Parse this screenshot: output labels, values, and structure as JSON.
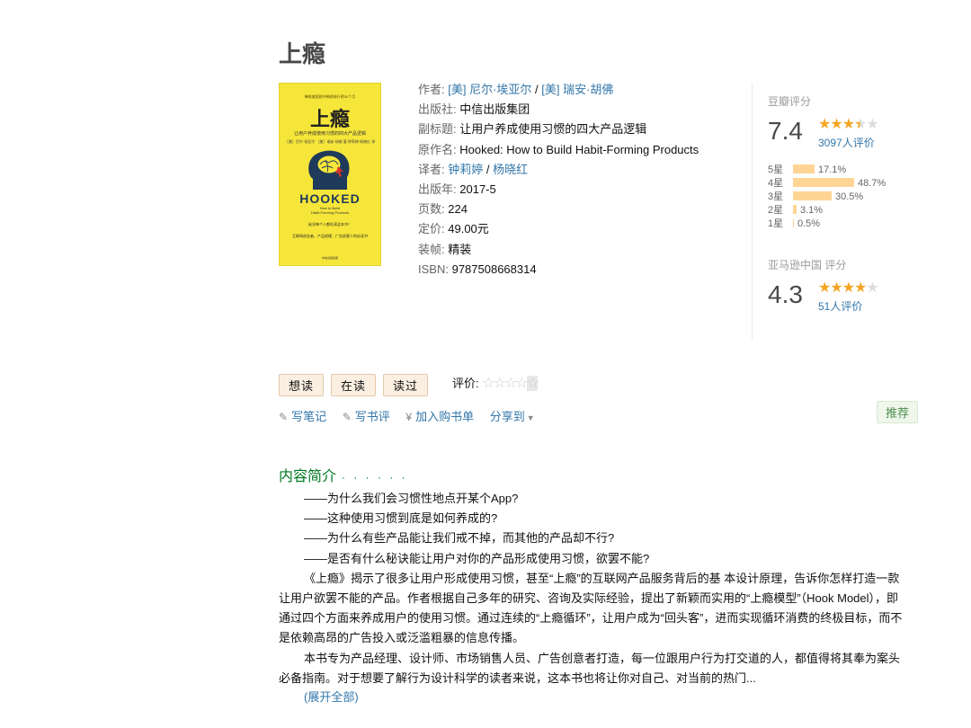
{
  "book": {
    "title": "上瘾",
    "cover": {
      "top_text": "蝉联美国图书畅销排行榜30个月",
      "title": "上瘾",
      "subtitle": "让用户养成使用习惯的四大产品逻辑",
      "authors": "［美］尼尔·埃亚尔  ［美］瑞安·胡佛 著  钟莉婷 杨晓红 译",
      "brand": "HOOKED",
      "en_line1": "How to Build",
      "en_line2": "Habit-Forming Products",
      "rec_line1": "硅谷每个人都在读这本书！",
      "rec_line2": "互联网创业者、产品经理、广告创意人的必读书",
      "publisher": "中信出版集团"
    },
    "info": {
      "author_label": "作者:",
      "author1": "[美] 尼尔·埃亚尔",
      "author_sep": " / ",
      "author2": "[美] 瑞安·胡佛",
      "publisher_label": "出版社:",
      "publisher": "中信出版集团",
      "subtitle_label": "副标题:",
      "subtitle": "让用户养成使用习惯的四大产品逻辑",
      "original_label": "原作名:",
      "original": "Hooked: How to Build Habit-Forming Products",
      "translator_label": "译者:",
      "translator1": "钟莉婷",
      "translator_sep": " / ",
      "translator2": "杨晓红",
      "year_label": "出版年:",
      "year": "2017-5",
      "pages_label": "页数:",
      "pages": "224",
      "price_label": "定价:",
      "price": "49.00元",
      "binding_label": "装帧:",
      "binding": "精装",
      "isbn_label": "ISBN:",
      "isbn": "9787508668314"
    }
  },
  "rating": {
    "douban_label": "豆瓣评分",
    "douban_score": "7.4",
    "douban_stars": 3.5,
    "douban_count": "3097人评价",
    "distribution": [
      {
        "star": "5星",
        "pct": "17.1%",
        "value": 17.1
      },
      {
        "star": "4星",
        "pct": "48.7%",
        "value": 48.7
      },
      {
        "star": "3星",
        "pct": "30.5%",
        "value": 30.5
      },
      {
        "star": "2星",
        "pct": "3.1%",
        "value": 3.1
      },
      {
        "star": "1星",
        "pct": "0.5%",
        "value": 0.5
      }
    ],
    "amazon_label": "亚马逊中国 评分",
    "amazon_score": "4.3",
    "amazon_stars": 4,
    "amazon_count": "51人评价"
  },
  "actions": {
    "want": "想读",
    "reading": "在读",
    "read": "读过",
    "my_rating_label": "评价:",
    "write_note": "写笔记",
    "write_review": "写书评",
    "add_cart": "加入购书单",
    "share": "分享到",
    "recommend": "推荐"
  },
  "intro": {
    "heading": "内容简介",
    "dots": "· · · · · ·",
    "q1": "——为什么我们会习惯性地点开某个App?",
    "q2": "——这种使用习惯到底是如何养成的?",
    "q3": "——为什么有些产品能让我们戒不掉，而其他的产品却不行?",
    "q4": "——是否有什么秘诀能让用户对你的产品形成使用习惯，欲罢不能?",
    "p1": "《上瘾》揭示了很多让用户形成使用习惯，甚至“上瘾”的互联网产品服务背后的基 本设计原理，告诉你怎样打造一款让用户欲罢不能的产品。作者根据自己多年的研究、咨询及实际经验，提出了新颖而实用的“上瘾模型”（Hook Model），即通过四个方面来养成用户的使用习惯。通过连续的“上瘾循环”，让用户成为“回头客”，进而实现循环消费的终极目标，而不是依赖高昂的广告投入或泛滥粗暴的信息传播。",
    "p2": "本书专为产品经理、设计师、市场销售人员、广告创意者打造，每一位跟用户行为打交道的人，都值得将其奉为案头必备指南。对于想要了解行为设计科学的读者来说，这本书也将让你对自己、对当前的热门...",
    "expand": "(展开全部)"
  },
  "colors": {
    "accent_link": "#3377aa",
    "star": "#f5a623",
    "bar": "#ffd596",
    "heading_green": "#007722",
    "cover_yellow": "#f6e63a"
  }
}
